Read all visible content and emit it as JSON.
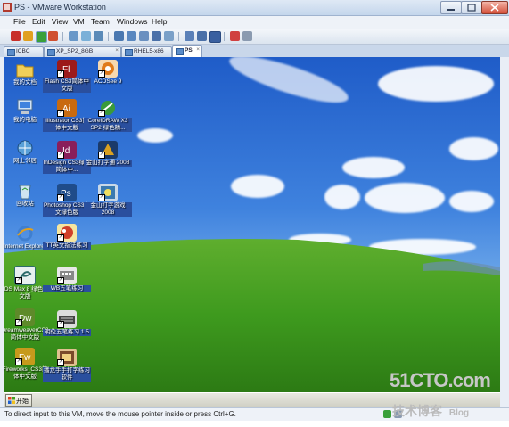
{
  "window": {
    "title": "PS - VMware Workstation",
    "menus": [
      "File",
      "Edit",
      "View",
      "VM",
      "Team",
      "Windows",
      "Help"
    ]
  },
  "tabs": [
    {
      "label": "ICBC",
      "active": false
    },
    {
      "label": "XP_SP2_8GB",
      "active": false
    },
    {
      "label": "RHEL5-x86",
      "active": false
    },
    {
      "label": "PS",
      "active": true
    }
  ],
  "desktop_icons": [
    {
      "label": "我的文档",
      "icon": "folder-docs-icon",
      "color": "#e6c25a"
    },
    {
      "label": "我的电脑",
      "icon": "my-computer-icon",
      "color": "#9fc3ea"
    },
    {
      "label": "网上邻居",
      "icon": "network-icon",
      "color": "#5aa0d8"
    },
    {
      "label": "回收站",
      "icon": "recycle-bin-icon",
      "color": "#8fb7d8"
    },
    {
      "label": "Internet Explorer",
      "icon": "ie-icon",
      "color": "#3f7fd0"
    },
    {
      "label": "3DS Max 8 绿色中文版",
      "icon": "3dsmax-icon",
      "color": "#2d6b6b"
    },
    {
      "label": "DreamweaverCS3简体中文版",
      "icon": "dreamweaver-icon",
      "color": "#5e8a2a"
    },
    {
      "label": "Fireworks_CS3简体中文版",
      "icon": "fireworks-icon",
      "color": "#c69a1c"
    },
    {
      "label": "Flash CS3简体中文版",
      "icon": "flash-icon",
      "color": "#9c1a1a"
    },
    {
      "label": "Illustrator CS3简体中文版",
      "icon": "illustrator-icon",
      "color": "#c86a10"
    },
    {
      "label": "InDesign CS3绿色简体中...",
      "icon": "indesign-icon",
      "color": "#8a1e5a"
    },
    {
      "label": "Photoshop CS3中文绿色版",
      "icon": "photoshop-icon",
      "color": "#1f4c8a"
    },
    {
      "label": "TT英文指法练习",
      "icon": "tt-typing-icon",
      "color": "#d0402a"
    },
    {
      "label": "WB五笔练习",
      "icon": "wubi-icon",
      "color": "#888888"
    },
    {
      "label": "明伦五笔练习 1.5",
      "icon": "keyboard-icon",
      "color": "#444444"
    },
    {
      "label": "播龙手手打字练习软件",
      "icon": "typing-game-icon",
      "color": "#7a4a2a"
    },
    {
      "label": "ACDSee 9",
      "icon": "acdsee-icon",
      "color": "#e07a1a"
    },
    {
      "label": "CorelDRAW X3 SP2 绿色精...",
      "icon": "coreldraw-icon",
      "color": "#3a9a3a"
    },
    {
      "label": "金山打字通 2008",
      "icon": "jinshan-typing-icon",
      "color": "#d8a020"
    },
    {
      "label": "金山打字游戏 2008",
      "icon": "jinshan-game-icon",
      "color": "#3a7ab0"
    }
  ],
  "taskbar": {
    "start_label": "开始"
  },
  "status": {
    "text": "To direct input to this VM, move the mouse pointer inside or press Ctrl+G."
  },
  "watermark": {
    "site": "51CTO.com",
    "tagline": "技术博客",
    "blog": "Blog"
  },
  "colors": {
    "accent": "#2f66c9",
    "chrome": "#dfe9f5",
    "close": "#d4503a"
  }
}
